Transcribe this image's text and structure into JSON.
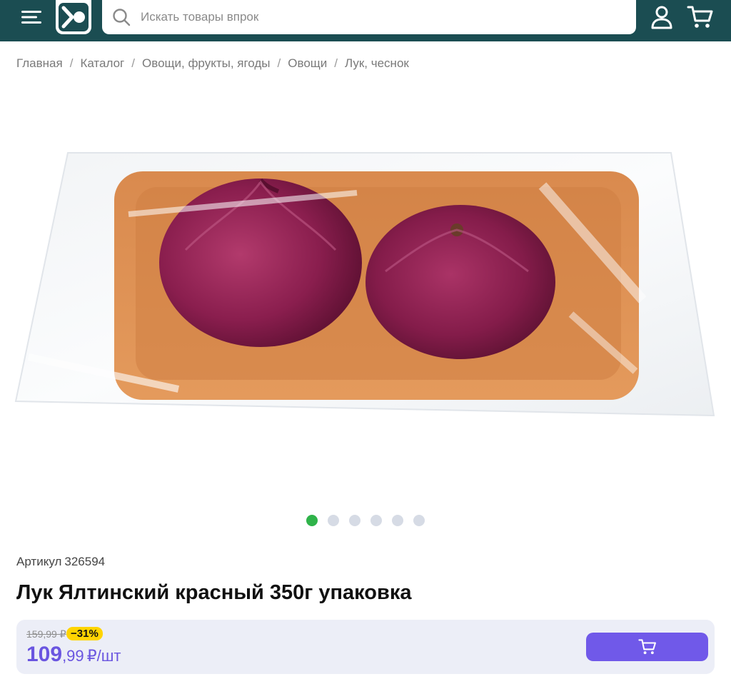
{
  "header": {
    "search_placeholder": "Искать товары впрок",
    "colors": {
      "bar": "#1b4d52",
      "accent": "#7059e9",
      "active_dot": "#2fb34a"
    },
    "icons": [
      "menu-icon",
      "logo-icon",
      "search-icon",
      "user-icon",
      "cart-icon"
    ]
  },
  "breadcrumb": {
    "items": [
      "Главная",
      "Каталог",
      "Овощи, фрукты, ягоды",
      "Овощи",
      "Лук, чеснок"
    ],
    "separator": "/"
  },
  "gallery": {
    "image_alt": "Лук Ялтинский красный 350г упаковка",
    "dots_total": 6,
    "active_index": 0
  },
  "product": {
    "sku_label": "Артикул",
    "sku_value": "326594",
    "title": "Лук Ялтинский красный 350г упаковка"
  },
  "price": {
    "old": "159,99 ₽",
    "discount": "−31%",
    "whole": "109",
    "fraction": ",99",
    "unit": "₽/шт"
  }
}
